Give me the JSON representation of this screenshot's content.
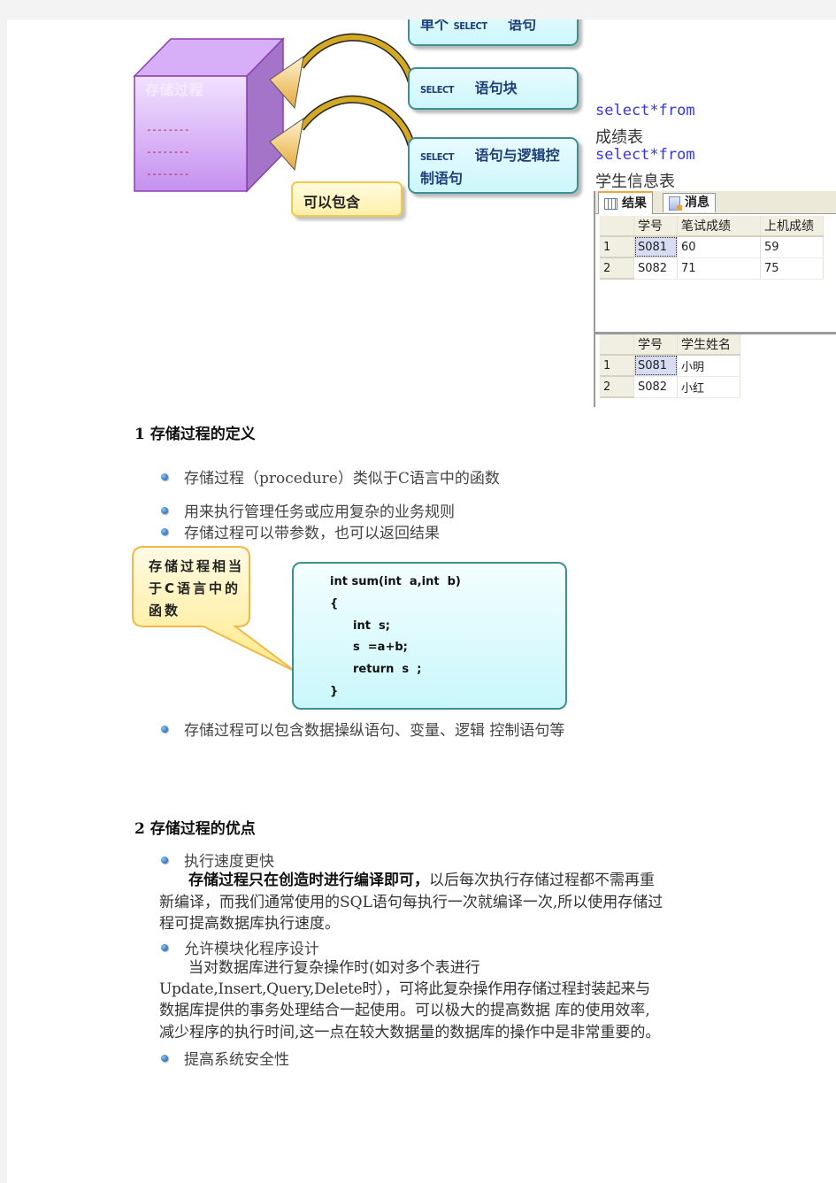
{
  "diagram": {
    "cube_title": "存储过程",
    "cube_lines": [
      "--------",
      "--------",
      "--------"
    ],
    "boxes": [
      {
        "keyword": "SELECT",
        "text": "单个",
        "text_after": "语句"
      },
      {
        "keyword": "SELECT",
        "text": "语句块"
      },
      {
        "keyword": "SELECT",
        "text": "语句与逻辑控",
        "text_line2": "制语句"
      }
    ],
    "note": "可以包含",
    "colors": {
      "cube": "#c79af0",
      "box_border": "#3e8f93",
      "note_border": "#f2c94a",
      "arrow": "#d4a820"
    }
  },
  "sql": {
    "queries": [
      {
        "keyword": "select*from",
        "table": "成绩表"
      },
      {
        "keyword": "select*from",
        "table": "学生信息表"
      }
    ],
    "keyword_color": "#3535e0"
  },
  "results": {
    "tabs": [
      {
        "label": "结果",
        "icon": "grid-icon",
        "active": true
      },
      {
        "label": "消息",
        "icon": "message-icon",
        "active": false
      }
    ],
    "grid1": {
      "columns": [
        "学号",
        "笔试成绩",
        "上机成绩"
      ],
      "rows": [
        {
          "n": "1",
          "cells": [
            "S081",
            "60",
            "59"
          ]
        },
        {
          "n": "2",
          "cells": [
            "S082",
            "71",
            "75"
          ]
        }
      ]
    },
    "grid2": {
      "columns": [
        "学号",
        "学生姓名"
      ],
      "rows": [
        {
          "n": "1",
          "cells": [
            "S081",
            "小明"
          ]
        },
        {
          "n": "2",
          "cells": [
            "S082",
            "小红"
          ]
        }
      ]
    }
  },
  "section1": {
    "heading": "1 存储过程的定义",
    "bullets": [
      "存储过程（procedure）类似于C语言中的函数",
      "用来执行管理任务或应用复杂的业务规则",
      "存储过程可以带参数，也可以返回结果"
    ],
    "callout": "存储过程相当于C语言中的函数",
    "code": [
      "int sum(int  a,int  b)",
      "{",
      "int  s;",
      "s  =a+b;",
      "return  s  ;",
      "}"
    ],
    "last_bullet": "存储过程可以包含数据操纵语句、变量、逻辑 控制语句等"
  },
  "section2": {
    "heading": "2 存储过程的优点",
    "items": [
      {
        "bullet": "执行速度更快",
        "bold": "存储过程只在创造时进行编译即可，",
        "lines": [
          "以后每次执行存储过程都不需再重",
          "新编译，而我们通常使用的SQL语句每执行一次就编译一次,所以使用存储过",
          "程可提高数据库执行速度。"
        ]
      },
      {
        "bullet": "允许模块化程序设计",
        "lines": [
          "当对数据库进行复杂操作时(如对多个表进行",
          "Update,Insert,Query,Delete时），可将此复杂操作用存储过程封装起来与",
          "数据库提供的事务处理结合一起使用。可以极大的提高数据 库的使用效率,",
          "减少程序的执行时间,这一点在较大数据量的数据库的操作中是非常重要的。"
        ]
      },
      {
        "bullet": "提高系统安全性"
      }
    ]
  }
}
